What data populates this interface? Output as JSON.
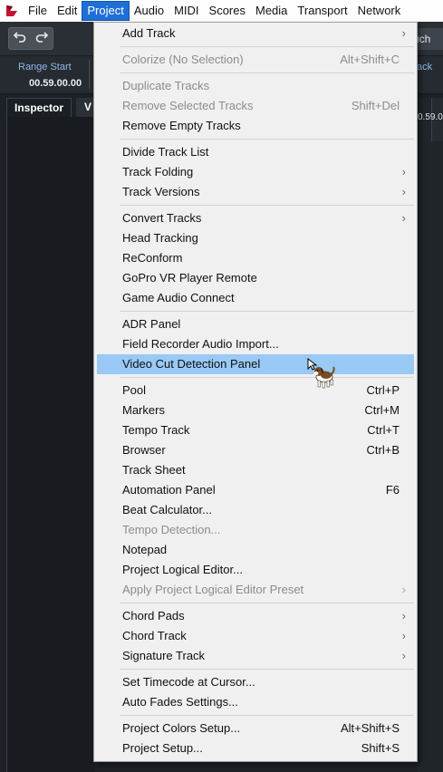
{
  "menubar": {
    "items": [
      {
        "label": "File",
        "active": false
      },
      {
        "label": "Edit",
        "active": false
      },
      {
        "label": "Project",
        "active": true
      },
      {
        "label": "Audio",
        "active": false
      },
      {
        "label": "MIDI",
        "active": false
      },
      {
        "label": "Scores",
        "active": false
      },
      {
        "label": "Media",
        "active": false
      },
      {
        "label": "Transport",
        "active": false
      },
      {
        "label": "Network",
        "active": false
      }
    ]
  },
  "toolbar": {
    "touch_label": "uch"
  },
  "infobar": {
    "range_start_label": "Range Start",
    "range_start_value": "00.59.00.00",
    "right_label": "ack"
  },
  "inspector": {
    "tab_label": "Inspector",
    "v_tab_label": "V",
    "right_value": "0.59.0"
  },
  "dropdown": {
    "groups": [
      [
        {
          "label": "Add Track",
          "submenu": true
        }
      ],
      [
        {
          "label": "Colorize (No Selection)",
          "shortcut": "Alt+Shift+C",
          "disabled": true
        }
      ],
      [
        {
          "label": "Duplicate Tracks",
          "disabled": true
        },
        {
          "label": "Remove Selected Tracks",
          "shortcut": "Shift+Del",
          "disabled": true
        },
        {
          "label": "Remove Empty Tracks"
        }
      ],
      [
        {
          "label": "Divide Track List"
        },
        {
          "label": "Track Folding",
          "submenu": true
        },
        {
          "label": "Track Versions",
          "submenu": true
        }
      ],
      [
        {
          "label": "Convert Tracks",
          "submenu": true
        },
        {
          "label": "Head Tracking"
        },
        {
          "label": "ReConform"
        },
        {
          "label": "GoPro VR Player Remote"
        },
        {
          "label": "Game Audio Connect"
        }
      ],
      [
        {
          "label": "ADR Panel"
        },
        {
          "label": "Field Recorder Audio Import..."
        },
        {
          "label": "Video Cut Detection Panel",
          "highlight": true
        }
      ],
      [
        {
          "label": "Pool",
          "shortcut": "Ctrl+P"
        },
        {
          "label": "Markers",
          "shortcut": "Ctrl+M"
        },
        {
          "label": "Tempo Track",
          "shortcut": "Ctrl+T"
        },
        {
          "label": "Browser",
          "shortcut": "Ctrl+B"
        },
        {
          "label": "Track Sheet"
        },
        {
          "label": "Automation Panel",
          "shortcut": "F6"
        },
        {
          "label": "Beat Calculator..."
        },
        {
          "label": "Tempo Detection...",
          "disabled": true
        },
        {
          "label": "Notepad"
        },
        {
          "label": "Project Logical Editor..."
        },
        {
          "label": "Apply Project Logical Editor Preset",
          "submenu": true,
          "disabled": true
        }
      ],
      [
        {
          "label": "Chord Pads",
          "submenu": true
        },
        {
          "label": "Chord Track",
          "submenu": true
        },
        {
          "label": "Signature Track",
          "submenu": true
        }
      ],
      [
        {
          "label": "Set Timecode at Cursor..."
        },
        {
          "label": "Auto Fades Settings..."
        }
      ],
      [
        {
          "label": "Project Colors Setup...",
          "shortcut": "Alt+Shift+S"
        },
        {
          "label": "Project Setup...",
          "shortcut": "Shift+S"
        }
      ]
    ]
  },
  "colors": {
    "menu_active": "#1f6fd6",
    "menu_highlight": "#99c9f5",
    "range_label": "#8fb8e8",
    "app_logo": "#c8102e"
  },
  "icons": {
    "app_logo": "cubase-logo-icon",
    "undo": "undo-icon",
    "redo": "redo-icon",
    "submenu": "chevron-right-icon",
    "cursor": "dog-cursor-icon"
  }
}
